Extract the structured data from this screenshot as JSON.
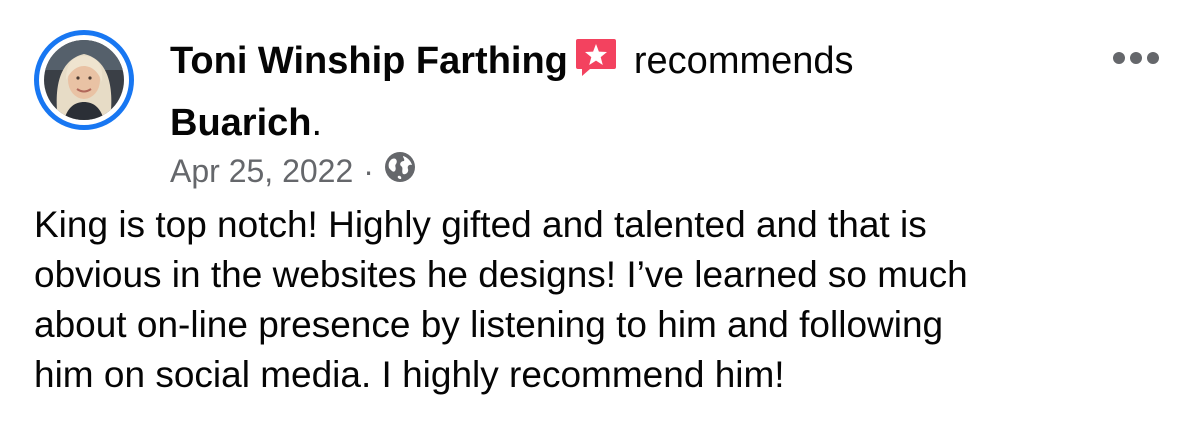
{
  "post": {
    "author": "Toni Winship Farthing",
    "action": "recommends",
    "page": "Buarich",
    "punctuation": ".",
    "date": "Apr 25, 2022",
    "separator": "·",
    "privacy_icon": "globe-icon",
    "badge_icon": "recommendation-badge-icon",
    "more_icon": "more-options-icon",
    "text": "King is top notch!  Highly gifted and talented and that is\nobvious in the websites he designs!  I’ve learned so much\nabout on-line presence by listening to him and following\nhim on social media. I highly recommend him!"
  },
  "colors": {
    "accent": "#1877f2",
    "badge": "#f3425f",
    "secondary_text": "#65676b",
    "primary_text": "#050505"
  }
}
